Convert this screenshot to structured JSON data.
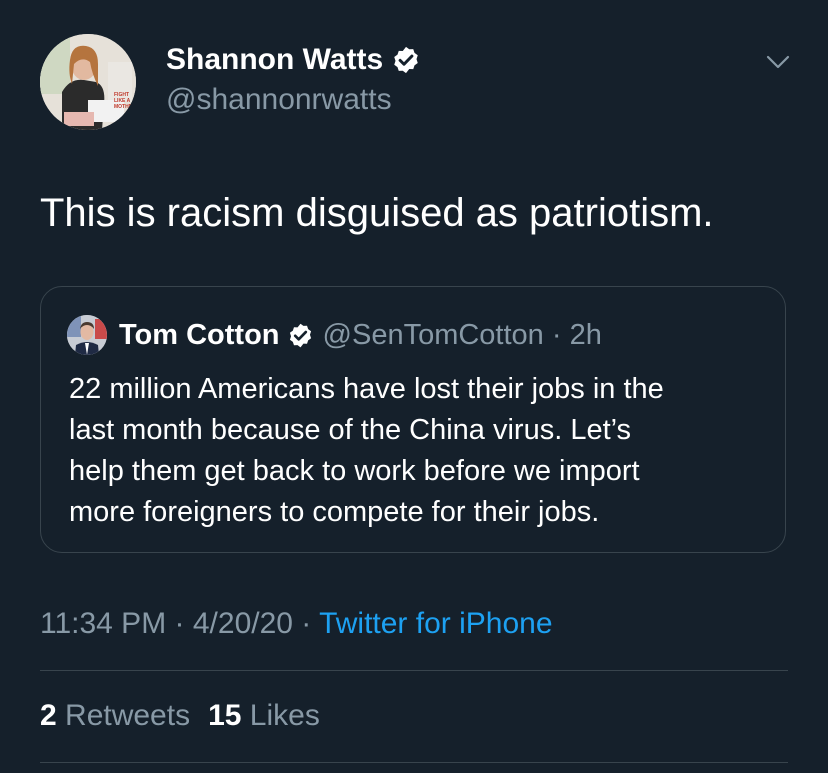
{
  "author": {
    "name": "Shannon Watts",
    "handle": "@shannonrwatts",
    "verified": true,
    "avatar_sign_text": "FIGHT LIKE A MOTHER"
  },
  "tweet": {
    "text": "This is racism disguised as patriotism."
  },
  "quoted_tweet": {
    "name": "Tom Cotton",
    "verified": true,
    "handle": "@SenTomCotton",
    "separator": " · ",
    "time": "2h",
    "lines": [
      "22 million Americans have lost their jobs in the",
      "last month because of the China virus. Let’s",
      "help them get back to work before we import",
      "more foreigners to compete for their jobs."
    ]
  },
  "meta": {
    "time": "11:34 PM",
    "sep1": " · ",
    "date": "4/20/20",
    "sep2": " · ",
    "source": "Twitter for iPhone"
  },
  "stats": {
    "retweets_count": "2",
    "retweets_label": " Retweets",
    "likes_count": "15",
    "likes_label": " Likes"
  },
  "icons": {
    "verified": "verified-badge-icon",
    "menu": "chevron-down-icon"
  },
  "colors": {
    "background": "#15202b",
    "text": "#ffffff",
    "secondary": "#8899a6",
    "accent": "#1da1f2",
    "border": "#38444d"
  }
}
